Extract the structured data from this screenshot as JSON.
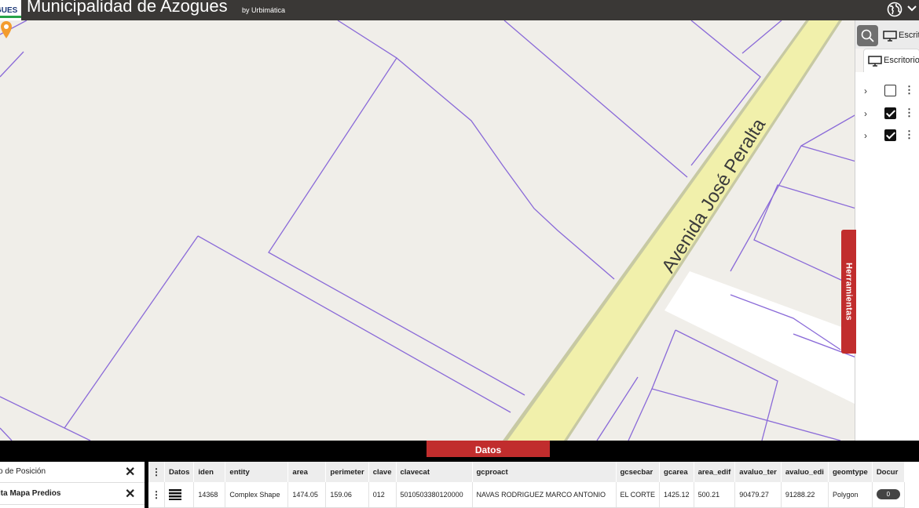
{
  "header": {
    "logo_text": "GUES",
    "title": "Municipalidad de Azogues",
    "subtitle": "by Urbimática",
    "globe_icon": "globe-icon",
    "menu_icon": "chevron-down-icon"
  },
  "map": {
    "street_label": "Avenida José Peralta",
    "marker_icon": "location-pin-icon",
    "marker_color": "#f39c2e",
    "parcel_line_color": "#8a6ad8",
    "road_fill_color": "#f1f0ab"
  },
  "tools_tab": {
    "label": "Herramientas"
  },
  "right_panel": {
    "search_icon": "search-icon",
    "top_label": "Escrit",
    "tab_label": "Escritorio",
    "layers": [
      {
        "checked": false
      },
      {
        "checked": true
      },
      {
        "checked": true
      }
    ]
  },
  "bottom": {
    "tab_label": "Datos",
    "left_items": [
      {
        "label": "o de Posición",
        "bold": false
      },
      {
        "label": "lta Mapa Predios",
        "bold": true
      }
    ],
    "table": {
      "columns": [
        "Datos",
        "iden",
        "entity",
        "area",
        "perimeter",
        "clave",
        "clavecat",
        "gcproact",
        "gcsecbar",
        "gcarea",
        "area_edif",
        "avaluo_ter",
        "avaluo_edi",
        "geomtype",
        "Docur"
      ],
      "rows": [
        {
          "iden": "14368",
          "entity": "Complex Shape",
          "area": "1474.05",
          "perimeter": "159.06",
          "clave": "012",
          "clavecat": "5010503380120000",
          "gcproact": "NAVAS RODRIGUEZ MARCO ANTONIO",
          "gcsecbar": "EL CORTE",
          "gcarea": "1425.12",
          "area_edif": "500.21",
          "avaluo_ter": "90479.27",
          "avaluo_edi": "91288.22",
          "geomtype": "Polygon",
          "docs": "0"
        }
      ]
    }
  }
}
